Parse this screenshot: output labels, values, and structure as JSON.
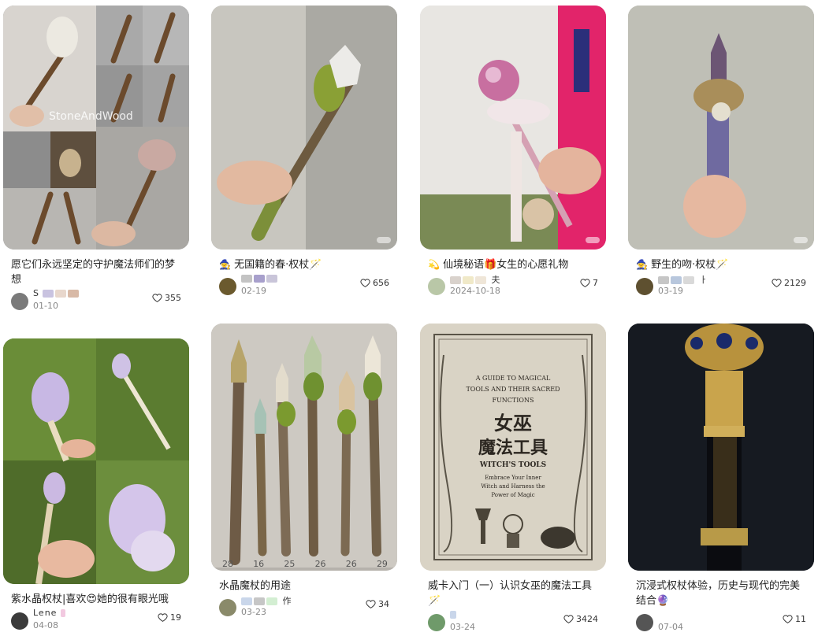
{
  "cards": [
    {
      "title": "愿它们永远坚定的守护魔法师们的梦想",
      "author": "S",
      "date": "01-10",
      "likes": "355",
      "watermark": "StoneAndWood",
      "avatar_color": "#7a7a7a"
    },
    {
      "title_icon": "🧙",
      "title": "无国籍的春·权杖🪄",
      "author": "",
      "date": "02-19",
      "likes": "656",
      "avatar_color": "#6b5a2e"
    },
    {
      "title_icon": "💫",
      "title": "仙境秘语🎁女生的心愿礼物",
      "author": "夫",
      "date": "2024-10-18",
      "likes": "7",
      "avatar_color": "#b9c7a7"
    },
    {
      "title_icon": "🧙",
      "title": "野生的吻·权杖🪄",
      "author": "ㅏ",
      "date": "03-19",
      "likes": "2129",
      "avatar_color": "#5e5030"
    },
    {
      "title": "紫水晶权杖|喜欢😍她的很有眼光哦",
      "author": "Lene",
      "date": "04-08",
      "likes": "19",
      "avatar_color": "#3b3b3b"
    },
    {
      "title": "水晶魔杖的用途",
      "author": "作",
      "date": "03-23",
      "likes": "34",
      "stick_numbers": [
        "28",
        "16",
        "25",
        "26",
        "26",
        "29"
      ],
      "avatar_color": "#8a8a6a"
    },
    {
      "title": "威卡入门（一）认识女巫的魔法工具🪄",
      "author": "",
      "date": "03-24",
      "likes": "3424",
      "book": {
        "line1": "A GUIDE TO MAGICAL",
        "line2": "TOOLS AND THEIR SACRED",
        "line3": "FUNCTIONS",
        "zh_line1": "女巫",
        "zh_line2": "魔法工具",
        "en_title": "WITCH'S TOOLS",
        "sub1": "Embrace Your Inner",
        "sub2": "Witch and Harness the",
        "sub3": "Power of Magic"
      },
      "avatar_color": "#6f9a6a"
    },
    {
      "title": "沉浸式权杖体验，历史与现代的完美结合🔮",
      "author": "",
      "date": "07-04",
      "likes": "11",
      "avatar_color": "#555555"
    }
  ],
  "colors": {
    "text": "#222222",
    "muted": "#888888",
    "heart": "#333333"
  }
}
